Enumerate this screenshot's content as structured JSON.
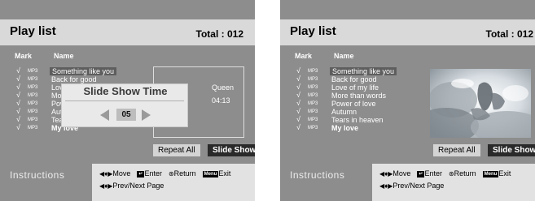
{
  "left": {
    "title": "Play list",
    "total": "Total : 012",
    "columns": {
      "mark": "Mark",
      "name": "Name"
    },
    "tracks": [
      {
        "check": "√",
        "format": "MP3",
        "title": "Something like you"
      },
      {
        "check": "√",
        "format": "MP3",
        "title": "Back for good"
      },
      {
        "check": "√",
        "format": "MP3",
        "title": "Love of my life"
      },
      {
        "check": "√",
        "format": "MP3",
        "title": "More than words"
      },
      {
        "check": "√",
        "format": "MP3",
        "title": "Power of love"
      },
      {
        "check": "√",
        "format": "MP3",
        "title": "Autumn"
      },
      {
        "check": "√",
        "format": "MP3",
        "title": "Tears in heaven"
      },
      {
        "check": "√",
        "format": "MP3",
        "title": "My love"
      }
    ],
    "info": {
      "artist": "Queen",
      "time": "04:13"
    },
    "repeat_label": "Repeat All",
    "slideshow_label": "Slide Show",
    "dialog": {
      "title": "Slide Show Time",
      "value": "05"
    },
    "instructions": {
      "label": "Instructions",
      "move_icon": "◀♦▶",
      "move": "Move",
      "enter_icon": "↵",
      "enter": "Enter",
      "return_icon": "⊛",
      "return": "Return",
      "exit_key": "Menu",
      "exit": "Exit",
      "page_icon": "◀♦▶",
      "page": "Prev/Next Page"
    }
  },
  "right": {
    "title": "Play list",
    "total": "Total : 012",
    "columns": {
      "mark": "Mark",
      "name": "Name"
    },
    "tracks": [
      {
        "check": "√",
        "format": "MP3",
        "title": "Something like you"
      },
      {
        "check": "√",
        "format": "MP3",
        "title": "Back for good"
      },
      {
        "check": "√",
        "format": "MP3",
        "title": "Love of my life"
      },
      {
        "check": "√",
        "format": "MP3",
        "title": "More than words"
      },
      {
        "check": "√",
        "format": "MP3",
        "title": "Power of love"
      },
      {
        "check": "√",
        "format": "MP3",
        "title": "Autumn"
      },
      {
        "check": "√",
        "format": "MP3",
        "title": "Tears in heaven"
      },
      {
        "check": "√",
        "format": "MP3",
        "title": "My love"
      }
    ],
    "repeat_label": "Repeat All",
    "slideshow_label": "Slide Show",
    "instructions": {
      "label": "Instructions",
      "move_icon": "◀♦▶",
      "move": "Move",
      "enter_icon": "↵",
      "enter": "Enter",
      "return_icon": "⊛",
      "return": "Return",
      "exit_key": "Menu",
      "exit": "Exit",
      "page_icon": "◀♦▶",
      "page": "Prev/Next Page"
    }
  },
  "colors": {
    "panel": "#8d8d8d",
    "tab": "#d9d9d9",
    "instructions_bg": "#e2e2e2",
    "selected_row": "#5e5e5e",
    "slideshow_button": "#2a2a2a"
  }
}
